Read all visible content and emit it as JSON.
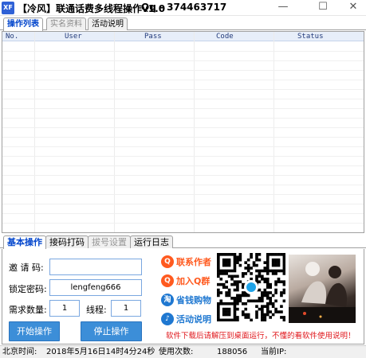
{
  "window": {
    "icon_text": "XF",
    "title": "【冷风】联通话费多线程操作v1.0",
    "qq": "Qq - 374463717",
    "minimize_glyph": "—",
    "maximize_glyph": "☐",
    "close_glyph": "✕"
  },
  "top_tabs": [
    {
      "label": "操作列表",
      "active": true
    },
    {
      "label": "实名资料",
      "active": false
    },
    {
      "label": "活动说明",
      "active": false
    }
  ],
  "grid": {
    "columns": [
      "No.",
      "User",
      "Pass",
      "Code",
      "Status"
    ],
    "rows": []
  },
  "bottom_tabs": [
    {
      "label": "基本操作",
      "active": true
    },
    {
      "label": "接码打码",
      "active": false
    },
    {
      "label": "拔号设置",
      "active": false,
      "disabled": true
    },
    {
      "label": "运行日志",
      "active": false
    }
  ],
  "form": {
    "invite_label": "邀 请 码:",
    "invite_value": "",
    "lock_label": "锁定密码:",
    "lock_value": "lengfeng666",
    "qty_label": "需求数量:",
    "qty_value": "1",
    "thread_label": "线程:",
    "thread_value": "1",
    "start_button": "开始操作",
    "stop_button": "停止操作"
  },
  "ads": [
    {
      "label": "联系作者",
      "icon": "qq-penguin-icon",
      "color": "#ff5a1f"
    },
    {
      "label": "加入Q群",
      "icon": "qq-group-icon",
      "color": "#ff5a1f"
    },
    {
      "label": "省钱购物",
      "icon": "taobao-icon",
      "color": "#1f78d1"
    },
    {
      "label": "活动说明",
      "icon": "activity-bell-icon",
      "color": "#1f78d1"
    }
  ],
  "notice": "软件下载后请解压到桌面运行，不懂的看软件使用说明！",
  "status": {
    "time_label": "北京时间:",
    "time_value": "2018年5月16日14时4分24秒",
    "usage_label": "使用次数:",
    "usage_value": "188056",
    "ip_label": "当前IP:",
    "ip_value": ""
  },
  "colors": {
    "accent": "#0044cc",
    "button_blue": "#3c8ed8",
    "notice_red": "#e0161b"
  }
}
